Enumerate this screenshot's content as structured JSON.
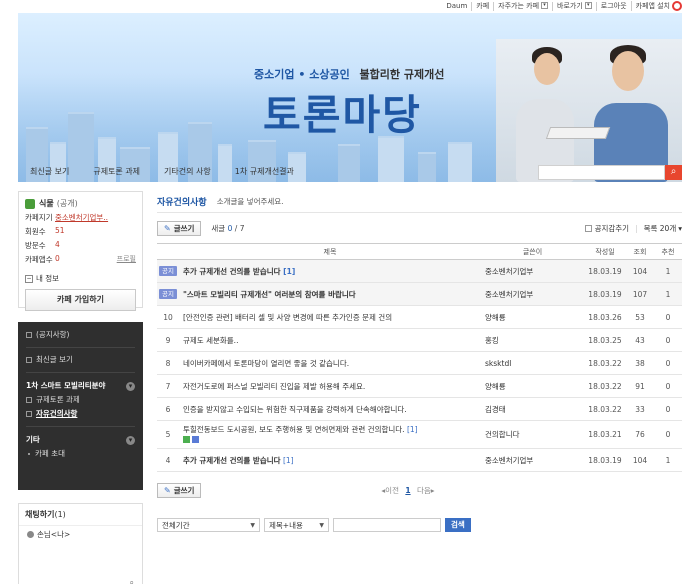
{
  "topbar": {
    "items": [
      "Daum",
      "카페",
      "자주가는 카페",
      "바로가기",
      "로그아웃",
      "카페앱 설치"
    ]
  },
  "banner": {
    "subtitle_left": "중소기업",
    "subtitle_dot": "•",
    "subtitle_mid": "소상공인",
    "subtitle_right": "불합리한 규제개선",
    "title": "토론마당",
    "tabs": [
      "최신글 보기",
      "규제토론 과제",
      "기타건의 사항",
      "1차 규제개선결과"
    ],
    "search_icon": "search-icon"
  },
  "cafe_info": {
    "name": "식물",
    "level": "(공개)",
    "rows": [
      {
        "k": "카페지기",
        "v": "중소벤처기업부.."
      },
      {
        "k": "회원수",
        "v": "51"
      },
      {
        "k": "방문수",
        "v": "4"
      },
      {
        "k": "카페앱수",
        "v": "0",
        "extra": "프로필"
      }
    ],
    "my_info": "내 정보",
    "join": "카페 가입하기"
  },
  "menu": {
    "top": [
      "(공지사항)",
      "최신글 보기"
    ],
    "group1": "1차 스마트 모빌리티분야",
    "group1_items": [
      "규제토론 과제",
      "자유건의사항"
    ],
    "group2": "기타",
    "group2_items": [
      "카페 초대"
    ]
  },
  "chat": {
    "title": "채팅하기",
    "count": "(1)",
    "user": "손님<나>"
  },
  "board": {
    "title": "자유건의사항",
    "desc": "소개글을 넣어주세요.",
    "write": "글쓰기",
    "count_label": "새글",
    "count_new": "0",
    "count_total": "/ 7",
    "hide_notice": "공지감추기",
    "list_count": "목록 20개",
    "columns": [
      "",
      "제목",
      "글쓴이",
      "작성일",
      "조회",
      "추천"
    ],
    "rows": [
      {
        "num": "공지",
        "title": "추가 규제개선 건의를 받습니다",
        "cmt": "[1]",
        "author": "중소벤처기업부",
        "date": "18.03.19",
        "views": "104",
        "likes": "1"
      },
      {
        "num": "공지",
        "title": "\"스마트 모빌리티 규제개선\" 여러분의 참여를 바랍니다",
        "cmt": "",
        "author": "중소벤처기업부",
        "date": "18.03.19",
        "views": "107",
        "likes": "1"
      },
      {
        "num": "10",
        "title": "[안전인증 관련] 배터리 셀 및 사양 변경에 따른 추가인증 문제 건의",
        "cmt": "",
        "author": "양해룡",
        "date": "18.03.26",
        "views": "53",
        "likes": "0"
      },
      {
        "num": "9",
        "title": "규제도 세분화를..",
        "cmt": "",
        "author": "홍킹",
        "date": "18.03.25",
        "views": "43",
        "likes": "0"
      },
      {
        "num": "8",
        "title": "네이버카페에서 토론마당이 열리면 좋을 것 같습니다.",
        "cmt": "",
        "author": "sksktdl",
        "date": "18.03.22",
        "views": "38",
        "likes": "0"
      },
      {
        "num": "7",
        "title": "자전거도로에 퍼스널 모빌리티 진입을 제발 허용해 주세요.",
        "cmt": "",
        "author": "양해룡",
        "date": "18.03.22",
        "views": "91",
        "likes": "0"
      },
      {
        "num": "6",
        "title": "인증을 받지않고 수입되는 위험한 직구제품을 강력하게 단속해야합니다.",
        "cmt": "",
        "author": "김경태",
        "date": "18.03.22",
        "views": "33",
        "likes": "0"
      },
      {
        "num": "5",
        "title": "투힐전동보드 도시공원, 보도 주행허용 및 면허면제와 관련 건의합니다.",
        "cmt": "[1]",
        "author": "건의합니다",
        "date": "18.03.21",
        "views": "76",
        "likes": "0"
      },
      {
        "num": "4",
        "title": "추가 규제개선 건의를 받습니다",
        "cmt": "[1]",
        "author": "중소벤처기업부",
        "date": "18.03.19",
        "views": "104",
        "likes": "1"
      }
    ],
    "pager_prev": "◂이전",
    "pager_cur": "1",
    "pager_next": "다음▸",
    "search_period": "전체기간",
    "search_type": "제목+내용",
    "search_btn": "검색"
  }
}
